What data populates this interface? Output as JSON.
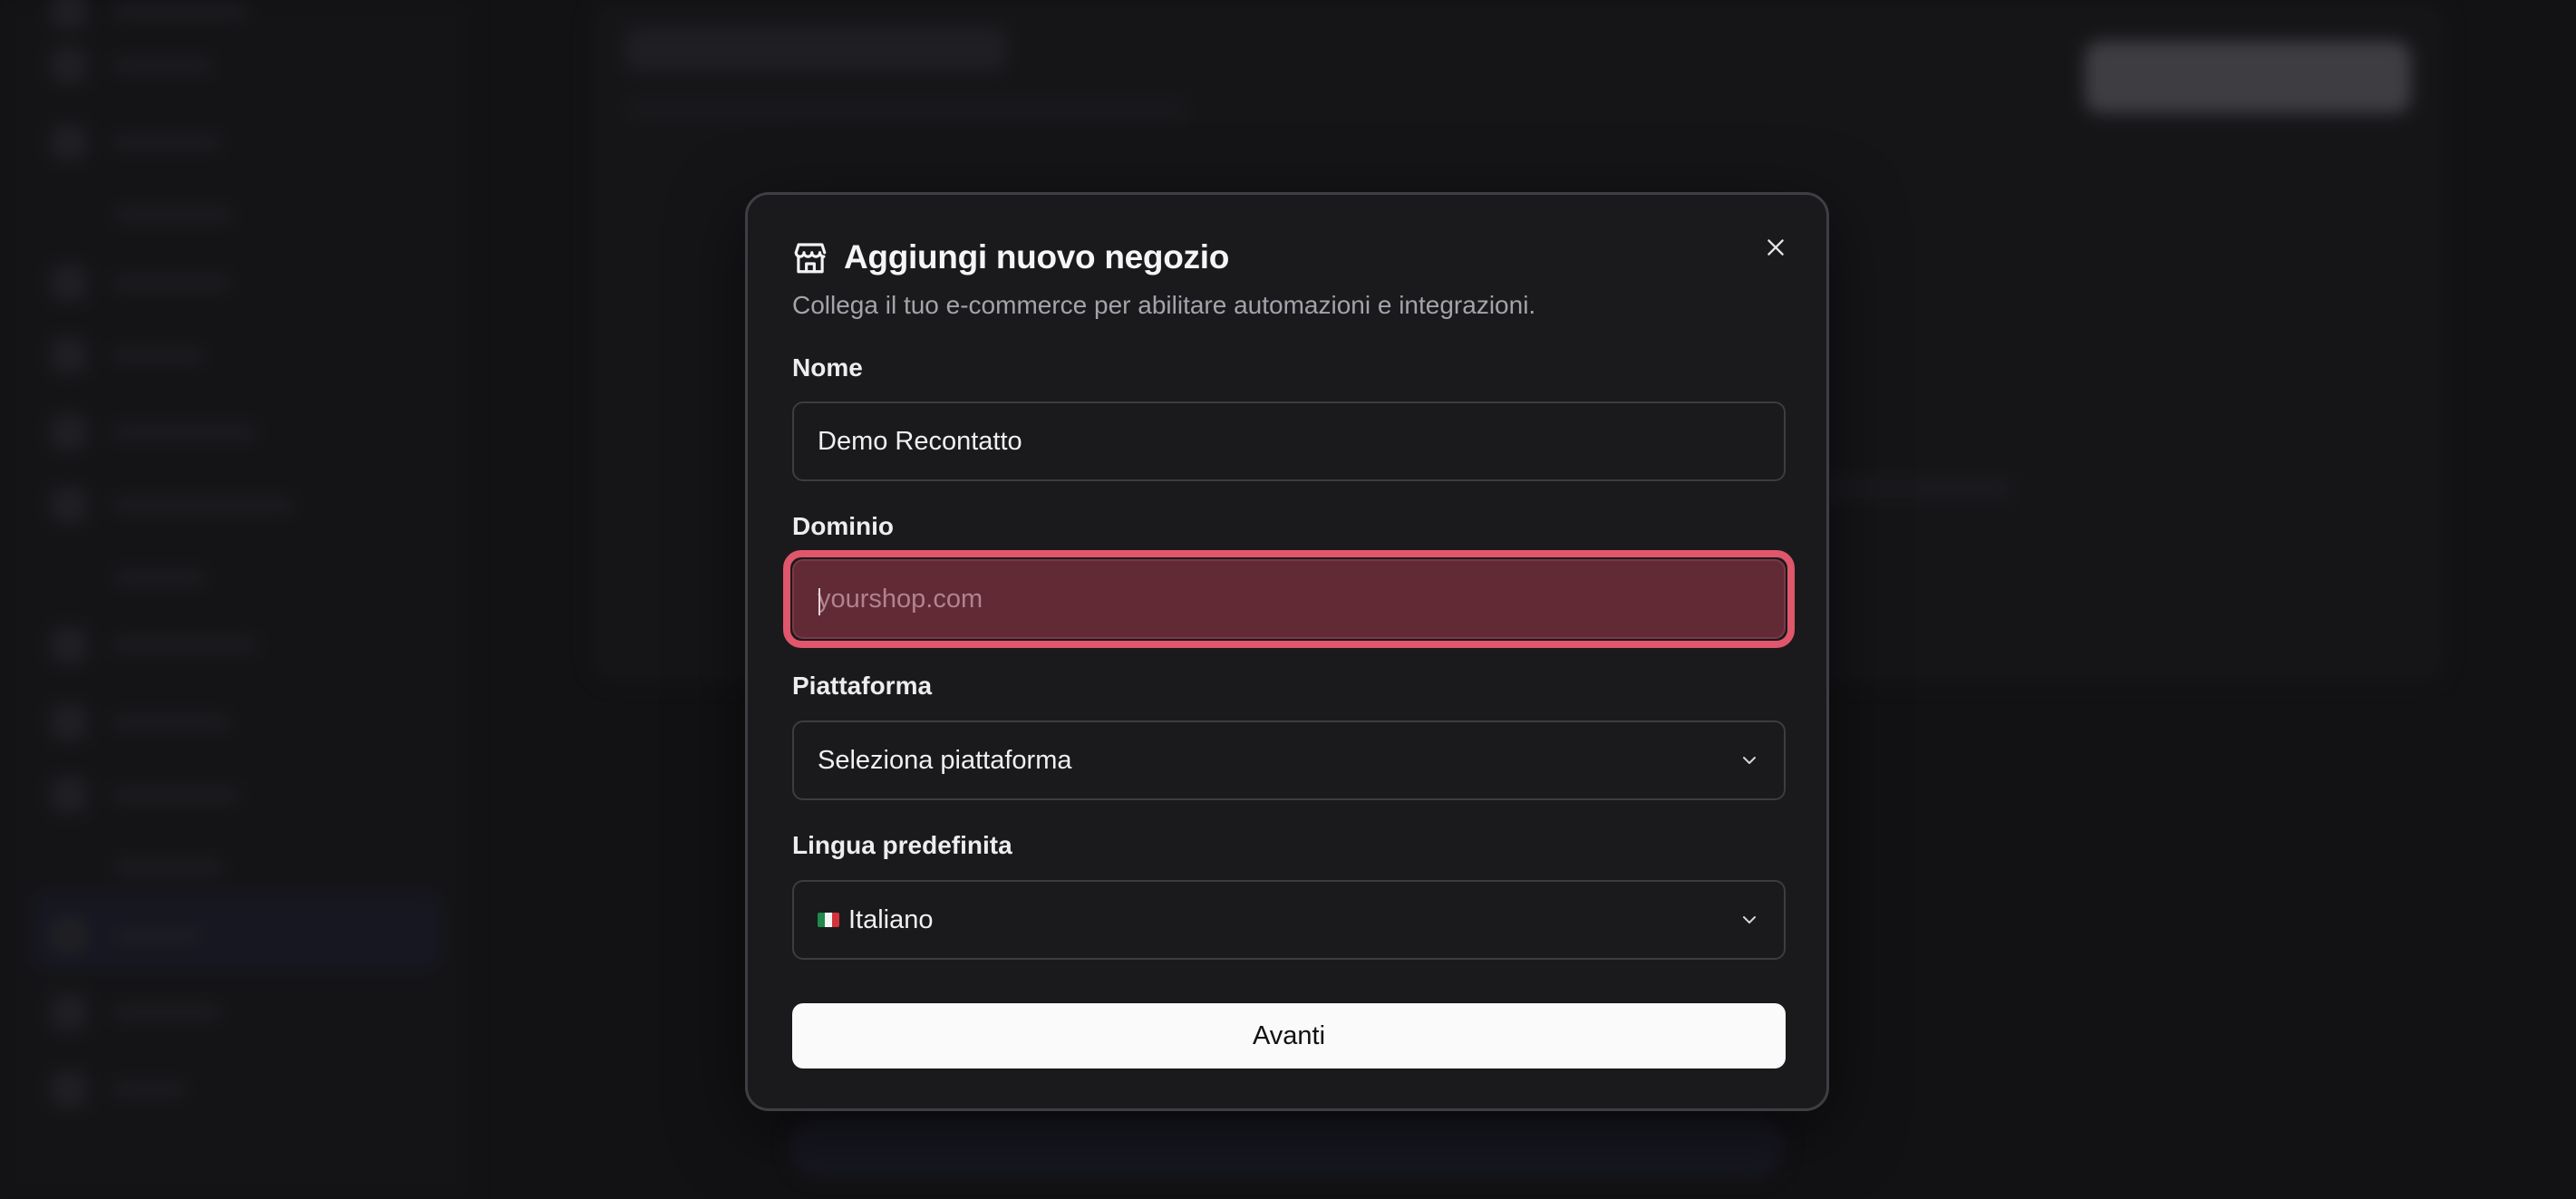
{
  "modal": {
    "title": "Aggiungi nuovo negozio",
    "subtitle": "Collega il tuo e-commerce per abilitare automazioni e integrazioni.",
    "title_icon": "store-icon",
    "close_icon": "close-icon",
    "fields": {
      "name": {
        "label": "Nome",
        "value": "Demo Recontatto"
      },
      "domain": {
        "label": "Dominio",
        "value": "",
        "placeholder": "yourshop.com",
        "state": "error"
      },
      "platform": {
        "label": "Piattaforma",
        "selected": "Seleziona piattaforma",
        "icon": "chevron-down-icon"
      },
      "language": {
        "label": "Lingua predefinita",
        "selected": "Italiano",
        "flag": "italy-flag-icon",
        "icon": "chevron-down-icon"
      }
    },
    "submit_label": "Avanti"
  },
  "colors": {
    "background": "#17171a",
    "modal_background": "#1a1a1d",
    "error_ring": "#e0566a",
    "error_fill": "#622a35",
    "primary_button": "#fafafa",
    "flag_green": "#1f8a4c",
    "flag_white": "#f4f4f4",
    "flag_red": "#d2323c"
  }
}
